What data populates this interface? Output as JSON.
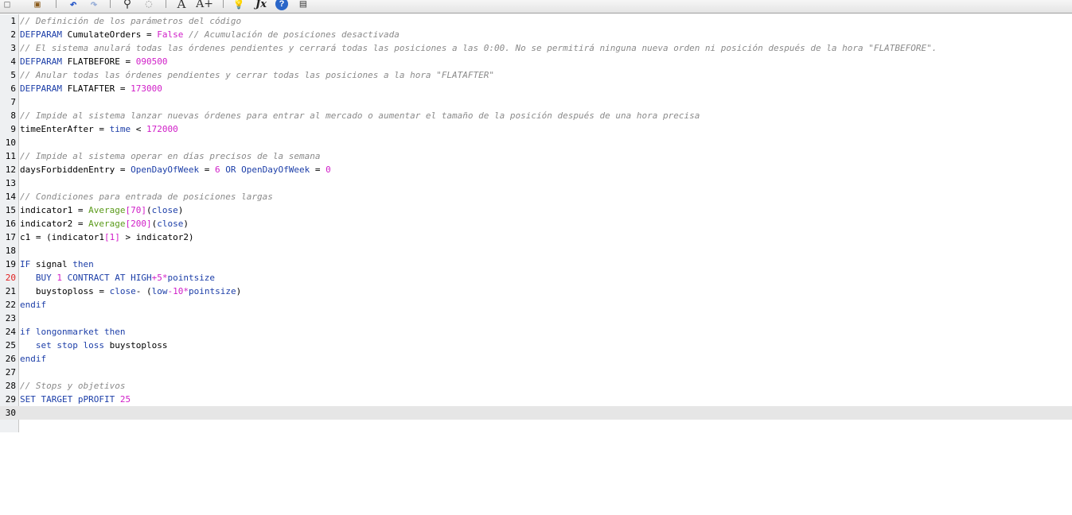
{
  "toolbar": {
    "buttons": [
      {
        "name": "new-icon",
        "glyph": "□"
      },
      {
        "name": "paste-icon",
        "glyph": "▣"
      },
      {
        "name": "undo-icon",
        "glyph": "↶"
      },
      {
        "name": "redo-icon",
        "glyph": "↷"
      },
      {
        "name": "search-icon",
        "glyph": "⚲"
      },
      {
        "name": "find-replace-icon",
        "glyph": "◌"
      },
      {
        "name": "font-decrease-icon",
        "glyph": "A"
      },
      {
        "name": "font-increase-icon",
        "glyph": "A+"
      },
      {
        "name": "hint-bulb-icon",
        "glyph": "💡"
      },
      {
        "name": "function-icon",
        "glyph": "Jx"
      },
      {
        "name": "help-icon",
        "glyph": "?"
      },
      {
        "name": "print-icon",
        "glyph": "▤"
      }
    ]
  },
  "editor": {
    "current_line": 30,
    "error_line": 20,
    "lines": [
      {
        "n": "1",
        "tokens": [
          {
            "t": "// Definición de los parámetros del código",
            "c": "com"
          }
        ]
      },
      {
        "n": "2",
        "tokens": [
          {
            "t": "DEFPARAM",
            "c": "kw"
          },
          {
            "t": " CumulateOrders = ",
            "c": "plain"
          },
          {
            "t": "False",
            "c": "bool"
          },
          {
            "t": " // Acumulación de posiciones desactivada",
            "c": "com"
          }
        ]
      },
      {
        "n": "3",
        "tokens": [
          {
            "t": "// El sistema anulará todas las órdenes pendientes y cerrará todas las posiciones a las 0:00. No se permitirá ninguna nueva orden ni posición después de la hora \"FLATBEFORE\".",
            "c": "com"
          }
        ]
      },
      {
        "n": "4",
        "tokens": [
          {
            "t": "DEFPARAM",
            "c": "kw"
          },
          {
            "t": " FLATBEFORE = ",
            "c": "plain"
          },
          {
            "t": "090500",
            "c": "num"
          }
        ]
      },
      {
        "n": "5",
        "tokens": [
          {
            "t": "// Anular todas las órdenes pendientes y cerrar todas las posiciones a la hora \"FLATAFTER\"",
            "c": "com"
          }
        ]
      },
      {
        "n": "6",
        "tokens": [
          {
            "t": "DEFPARAM",
            "c": "kw"
          },
          {
            "t": " FLATAFTER = ",
            "c": "plain"
          },
          {
            "t": "173000",
            "c": "num"
          }
        ]
      },
      {
        "n": "7",
        "tokens": []
      },
      {
        "n": "8",
        "tokens": [
          {
            "t": "// Impide al sistema lanzar nuevas órdenes para entrar al mercado o aumentar el tamaño de la posición después de una hora precisa",
            "c": "com"
          }
        ]
      },
      {
        "n": "9",
        "tokens": [
          {
            "t": "timeEnterAfter = ",
            "c": "plain"
          },
          {
            "t": "time",
            "c": "kw"
          },
          {
            "t": " < ",
            "c": "plain"
          },
          {
            "t": "172000",
            "c": "num"
          }
        ]
      },
      {
        "n": "10",
        "tokens": []
      },
      {
        "n": "11",
        "tokens": [
          {
            "t": "// Impide al sistema operar en días precisos de la semana",
            "c": "com"
          }
        ]
      },
      {
        "n": "12",
        "tokens": [
          {
            "t": "daysForbiddenEntry = ",
            "c": "plain"
          },
          {
            "t": "OpenDayOfWeek",
            "c": "kw"
          },
          {
            "t": " = ",
            "c": "plain"
          },
          {
            "t": "6",
            "c": "num"
          },
          {
            "t": " OR ",
            "c": "kw"
          },
          {
            "t": "OpenDayOfWeek",
            "c": "kw"
          },
          {
            "t": " = ",
            "c": "plain"
          },
          {
            "t": "0",
            "c": "num"
          }
        ]
      },
      {
        "n": "13",
        "tokens": []
      },
      {
        "n": "14",
        "tokens": [
          {
            "t": "// Condiciones para entrada de posiciones largas",
            "c": "com"
          }
        ]
      },
      {
        "n": "15",
        "tokens": [
          {
            "t": "indicator1 = ",
            "c": "plain"
          },
          {
            "t": "Average",
            "c": "fn"
          },
          {
            "t": "[70]",
            "c": "num"
          },
          {
            "t": "(",
            "c": "plain"
          },
          {
            "t": "close",
            "c": "kw"
          },
          {
            "t": ")",
            "c": "plain"
          }
        ]
      },
      {
        "n": "16",
        "tokens": [
          {
            "t": "indicator2 = ",
            "c": "plain"
          },
          {
            "t": "Average",
            "c": "fn"
          },
          {
            "t": "[200]",
            "c": "num"
          },
          {
            "t": "(",
            "c": "plain"
          },
          {
            "t": "close",
            "c": "kw"
          },
          {
            "t": ")",
            "c": "plain"
          }
        ]
      },
      {
        "n": "17",
        "tokens": [
          {
            "t": "c1 = (indicator1",
            "c": "plain"
          },
          {
            "t": "[1]",
            "c": "num"
          },
          {
            "t": " > indicator2)",
            "c": "plain"
          }
        ]
      },
      {
        "n": "18",
        "tokens": []
      },
      {
        "n": "19",
        "tokens": [
          {
            "t": "IF",
            "c": "kw"
          },
          {
            "t": " signal ",
            "c": "plain"
          },
          {
            "t": "then",
            "c": "kw"
          }
        ]
      },
      {
        "n": "20",
        "tokens": [
          {
            "t": "   BUY ",
            "c": "kw"
          },
          {
            "t": "1",
            "c": "num"
          },
          {
            "t": " CONTRACT AT HIGH",
            "c": "kw"
          },
          {
            "t": "+5*",
            "c": "num"
          },
          {
            "t": "pointsize",
            "c": "kw"
          }
        ]
      },
      {
        "n": "21",
        "tokens": [
          {
            "t": "   buystoploss = ",
            "c": "plain"
          },
          {
            "t": "close",
            "c": "kw"
          },
          {
            "t": "- (",
            "c": "plain"
          },
          {
            "t": "low",
            "c": "kw"
          },
          {
            "t": "-10*",
            "c": "num"
          },
          {
            "t": "pointsize",
            "c": "kw"
          },
          {
            "t": ")",
            "c": "plain"
          }
        ]
      },
      {
        "n": "22",
        "tokens": [
          {
            "t": "endif",
            "c": "kw"
          }
        ]
      },
      {
        "n": "23",
        "tokens": []
      },
      {
        "n": "24",
        "tokens": [
          {
            "t": "if",
            "c": "kw"
          },
          {
            "t": " ",
            "c": "plain"
          },
          {
            "t": "longonmarket",
            "c": "kw"
          },
          {
            "t": " ",
            "c": "plain"
          },
          {
            "t": "then",
            "c": "kw"
          }
        ]
      },
      {
        "n": "25",
        "tokens": [
          {
            "t": "   set stop loss",
            "c": "kw"
          },
          {
            "t": " buystoploss",
            "c": "plain"
          }
        ]
      },
      {
        "n": "26",
        "tokens": [
          {
            "t": "endif",
            "c": "kw"
          }
        ]
      },
      {
        "n": "27",
        "tokens": []
      },
      {
        "n": "28",
        "tokens": [
          {
            "t": "// Stops y objetivos",
            "c": "com"
          }
        ]
      },
      {
        "n": "29",
        "tokens": [
          {
            "t": "SET TARGET pPROFIT ",
            "c": "kw"
          },
          {
            "t": "25",
            "c": "num"
          }
        ]
      },
      {
        "n": "30",
        "tokens": []
      }
    ]
  },
  "colors": {
    "comment": "#8a8a8a",
    "keyword": "#1c3ea8",
    "number": "#d01ec8",
    "function": "#5a9a1a",
    "error_line_number": "#e02020",
    "current_line_bg": "#e6e6e6"
  }
}
